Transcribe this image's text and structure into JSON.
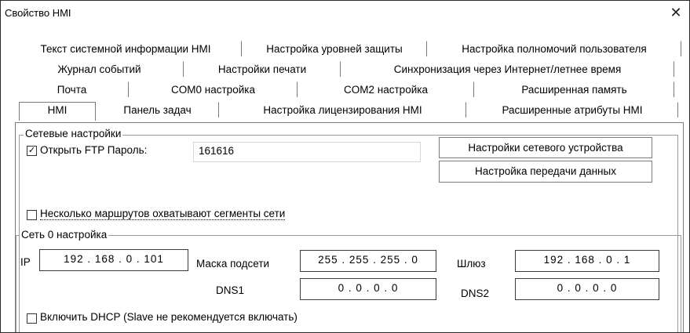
{
  "window": {
    "title": "Свойство HMI",
    "close_glyph": "✕"
  },
  "tabs": {
    "row1": [
      "Текст системной информации HMI",
      "Настройка уровней защиты",
      "Настройка полномочий пользователя"
    ],
    "row2": [
      "Журнал событий",
      "Настройки печати",
      "Синхронизация через Интернет/летнее время"
    ],
    "row3": [
      "Почта",
      "COM0 настройка",
      "COM2 настройка",
      "Расширенная память"
    ],
    "row4": [
      "HMI",
      "Панель задач",
      "Настройка лицензирования HMI",
      "Расширенные атрибуты HMI"
    ]
  },
  "network": {
    "group_label": "Сетевые настройки",
    "ftp_checkbox_mark": "✓",
    "ftp_label": "Открыть FTP Пароль:",
    "ftp_password": "161616",
    "btn_network_device": "Настройки сетевого устройства",
    "btn_data_transfer": "Настройка передачи данных",
    "multi_route_label": "Несколько маршрутов охватывают сегменты сети"
  },
  "net0": {
    "group_label": "Сеть 0 настройка",
    "ip_label": "IP",
    "ip_value": "192 . 168 .  0  . 101",
    "mask_label": "Маска подсети",
    "mask_value": "255 . 255 . 255 .  0",
    "gateway_label": "Шлюз",
    "gateway_value": "192 . 168 .  0  .  1",
    "dns1_label": "DNS1",
    "dns1_value": "0  .  0  .  0  .  0",
    "dns2_label": "DNS2",
    "dns2_value": "0  .  0  .  0  .  0",
    "dhcp_label": "Включить DHCP (Slave не рекомендуется включать)"
  }
}
